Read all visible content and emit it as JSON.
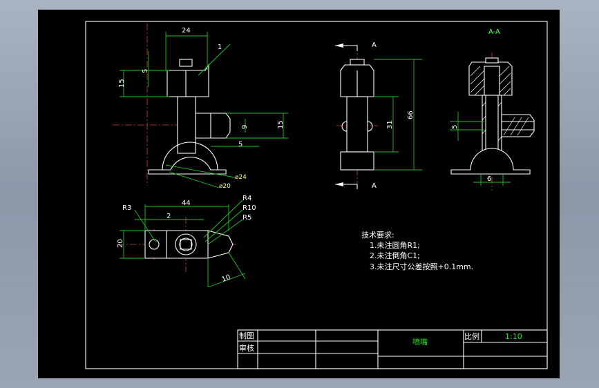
{
  "view_a_labels": {
    "top": "A",
    "bottom": "A"
  },
  "section_label": "A-A",
  "dimensions": {
    "front_width": "24",
    "chamfer": "1",
    "top_height_5": "5",
    "top_height_15": "15",
    "nozzle_dia": "9",
    "nozzle_height": "15",
    "nozzle_len": "5",
    "base_dia_24": "⌀24",
    "base_dia_20": "⌀20",
    "side_height_31": "31",
    "side_height_66": "66",
    "section_5": "5",
    "section_6": "6",
    "plan_width_44": "44",
    "plan_2": "2",
    "plan_height_20": "20",
    "plan_10": "10",
    "r3": "R3",
    "r4": "R4",
    "r10": "R10",
    "r5": "R5"
  },
  "notes": {
    "title": "技术要求:",
    "items": [
      "1.未注圆角R1;",
      "2.未注倒角C1;",
      "3.未注尺寸公差按照+0.1mm."
    ]
  },
  "title_block": {
    "drawn_label": "制图",
    "checked_label": "审核",
    "part_name": "喷嘴",
    "scale_label": "比例",
    "scale_value": "1:10"
  },
  "colors": {
    "background": "#000000",
    "geometry": "#ffffff",
    "dimension": "#22c322",
    "centerline": "#d04040"
  }
}
